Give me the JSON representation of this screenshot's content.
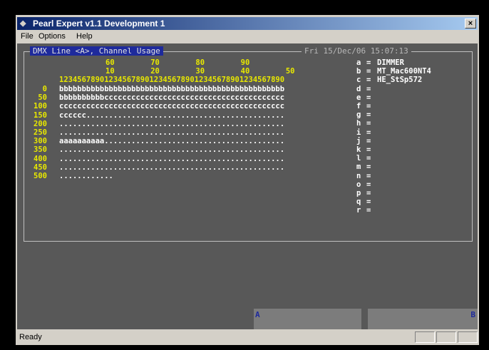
{
  "window": {
    "title": "Pearl Expert v1.1 Development 1",
    "close_label": "×"
  },
  "menu": {
    "items": [
      "File",
      "Options",
      "Help"
    ]
  },
  "console": {
    "frame_title": "DMX Line <A>, Channel Usage",
    "date_time": "Fri 15/Dec/06   15:07:13",
    "tens_row1": "60        70        80        90",
    "tens_row2": "10        20        30        40        50",
    "digits_row": "12345678901234567890123456789012345678901234567890",
    "channels": [
      {
        "start": "0",
        "usage": "bbbbbbbbbbbbbbbbbbbbbbbbbbbbbbbbbbbbbbbbbbbbbbbbbb"
      },
      {
        "start": "50",
        "usage": "bbbbbbbbbbcccccccccccccccccccccccccccccccccccccccc"
      },
      {
        "start": "100",
        "usage": "cccccccccccccccccccccccccccccccccccccccccccccccccc"
      },
      {
        "start": "150",
        "usage": "cccccc............................................"
      },
      {
        "start": "200",
        "usage": ".................................................."
      },
      {
        "start": "250",
        "usage": ".................................................."
      },
      {
        "start": "300",
        "usage": "aaaaaaaaaa........................................"
      },
      {
        "start": "350",
        "usage": ".................................................."
      },
      {
        "start": "400",
        "usage": ".................................................."
      },
      {
        "start": "450",
        "usage": ".................................................."
      },
      {
        "start": "500",
        "usage": "............"
      }
    ],
    "fixtures": [
      {
        "key": "a",
        "name": "DIMMER"
      },
      {
        "key": "b",
        "name": "MT_Mac600NT4"
      },
      {
        "key": "c",
        "name": "HE_StSp572"
      },
      {
        "key": "d",
        "name": ""
      },
      {
        "key": "e",
        "name": ""
      },
      {
        "key": "f",
        "name": ""
      },
      {
        "key": "g",
        "name": ""
      },
      {
        "key": "h",
        "name": ""
      },
      {
        "key": "i",
        "name": ""
      },
      {
        "key": "j",
        "name": ""
      },
      {
        "key": "k",
        "name": ""
      },
      {
        "key": "l",
        "name": ""
      },
      {
        "key": "m",
        "name": ""
      },
      {
        "key": "n",
        "name": ""
      },
      {
        "key": "o",
        "name": ""
      },
      {
        "key": "p",
        "name": ""
      },
      {
        "key": "q",
        "name": ""
      },
      {
        "key": "r",
        "name": ""
      }
    ]
  },
  "panels": {
    "a_label": "A",
    "b_label": "B"
  },
  "status": {
    "text": "Ready"
  },
  "colors": {
    "title_start": "#0a246a",
    "title_end": "#a6caf0",
    "console_bg": "#585858",
    "yellow": "#e8e800"
  }
}
